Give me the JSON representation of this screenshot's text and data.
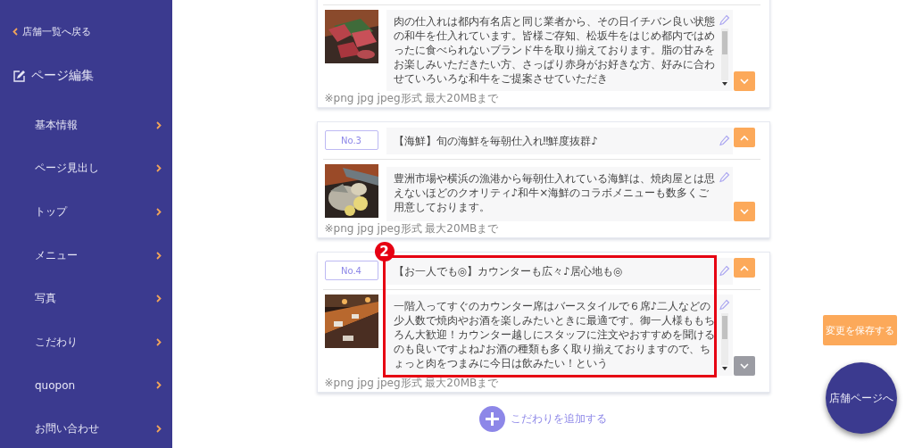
{
  "sidebar": {
    "back_link": "店舗一覧へ戻る",
    "section_title": "ページ編集",
    "items": [
      "基本情報",
      "ページ見出し",
      "トップ",
      "メニュー",
      "写真",
      "こだわり",
      "quopon",
      "お問い合わせ"
    ]
  },
  "cards": [
    {
      "description": "肉の仕入れは都内有名店と同じ業者から、その日イチバン良い状態の和牛を仕入れています。皆様ご存知、松坂牛をはじめ都内ではめったに食べられないブランド牛を取り揃えております。脂の甘みをお楽しみいただきたい方、さっぱり赤身がお好きな方、好みに合わせていろいろな和牛をご提案させていただき",
      "note": "※png jpg jpeg形式 最大20MBまで",
      "scrollable": true,
      "down_disabled": false
    },
    {
      "number": "No.3",
      "title": "【海鮮】旬の海鮮を毎朝仕入れ‼鮮度抜群♪",
      "description": "豊洲市場や横浜の漁港から毎朝仕入れている海鮮は、焼肉屋とは思えないほどのクオリティ♪和牛×海鮮のコラボメニューも数多くご用意しております。",
      "note": "※png jpg jpeg形式 最大20MBまで",
      "scrollable": false,
      "down_disabled": false
    },
    {
      "number": "No.4",
      "title": "【お一人でも◎】カウンターも広々♪居心地も◎",
      "description": "一階入ってすぐのカウンター席はバースタイルで６席♪二人などの少人数で焼肉やお酒を楽しみたいときに最適です。御一人様ももちろん大歓迎！カウンター越しにスタッフに注文やおすすめを聞けるのも良いですよね♪お酒の種類も多く取り揃えておりますので、ちょっと肉をつまみに今日は飲みたい！という",
      "note": "※png jpg jpeg形式 最大20MBまで",
      "scrollable": true,
      "down_disabled": true,
      "annotation": "2"
    }
  ],
  "add_button": "こだわりを追加する",
  "save_button": "変更を保存する",
  "store_page_button": "店舗ページへ"
}
